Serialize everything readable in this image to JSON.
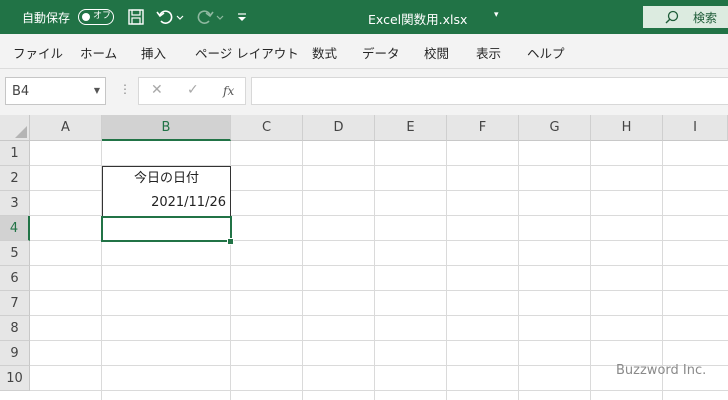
{
  "titlebar": {
    "autosave_label": "自動保存",
    "autosave_state": "オフ",
    "document_title": "Excel関数用.xlsx",
    "title_caret": "▾",
    "search_label": "検索"
  },
  "ribbon": {
    "menu": [
      "ファイル",
      "ホーム",
      "挿入",
      "ページ レイアウト",
      "数式",
      "データ",
      "校閲",
      "表示",
      "ヘルプ"
    ]
  },
  "formula_bar": {
    "name_box": "B4",
    "cancel_glyph": "✕",
    "enter_glyph": "✓",
    "fx_label": "fx",
    "formula_value": ""
  },
  "sheet": {
    "columns": [
      "A",
      "B",
      "C",
      "D",
      "E",
      "F",
      "G",
      "H",
      "I"
    ],
    "rows": [
      "1",
      "2",
      "3",
      "4",
      "5",
      "6",
      "7",
      "8",
      "9",
      "10"
    ],
    "selected_cell": "B4",
    "cells": {
      "B2": "今日の日付",
      "B3": "2021/11/26"
    }
  },
  "watermark": "Buzzword Inc."
}
